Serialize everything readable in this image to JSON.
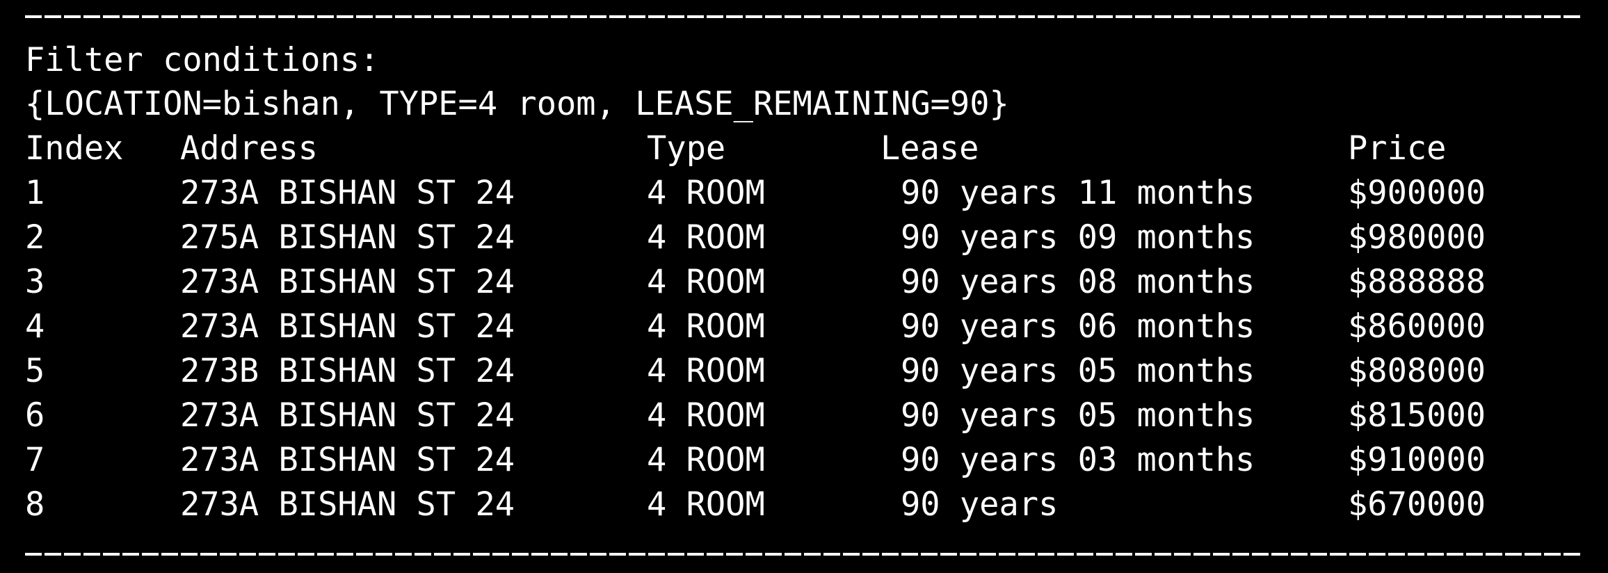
{
  "terminal": {
    "rule": "-----------------------------------------------------------------------------------------------",
    "filter_heading": "Filter conditions:",
    "filter_values": "{LOCATION=bishan, TYPE=4 room, LEASE_REMAINING=90}",
    "columns": [
      "Index",
      "Address",
      "Type",
      "Lease",
      "Price"
    ],
    "rows": [
      {
        "index": "1",
        "address": "273A BISHAN ST 24",
        "type": "4 ROOM",
        "lease": "90 years 11 months",
        "price": "$900000"
      },
      {
        "index": "2",
        "address": "275A BISHAN ST 24",
        "type": "4 ROOM",
        "lease": "90 years 09 months",
        "price": "$980000"
      },
      {
        "index": "3",
        "address": "273A BISHAN ST 24",
        "type": "4 ROOM",
        "lease": "90 years 08 months",
        "price": "$888888"
      },
      {
        "index": "4",
        "address": "273A BISHAN ST 24",
        "type": "4 ROOM",
        "lease": "90 years 06 months",
        "price": "$860000"
      },
      {
        "index": "5",
        "address": "273B BISHAN ST 24",
        "type": "4 ROOM",
        "lease": "90 years 05 months",
        "price": "$808000"
      },
      {
        "index": "6",
        "address": "273A BISHAN ST 24",
        "type": "4 ROOM",
        "lease": "90 years 05 months",
        "price": "$815000"
      },
      {
        "index": "7",
        "address": "273A BISHAN ST 24",
        "type": "4 ROOM",
        "lease": "90 years 03 months",
        "price": "$910000"
      },
      {
        "index": "8",
        "address": "273A BISHAN ST 24",
        "type": "4 ROOM",
        "lease": "90 years",
        "price": "$670000"
      }
    ],
    "colors": {
      "background": "#000000",
      "text": "#ffffff"
    }
  }
}
